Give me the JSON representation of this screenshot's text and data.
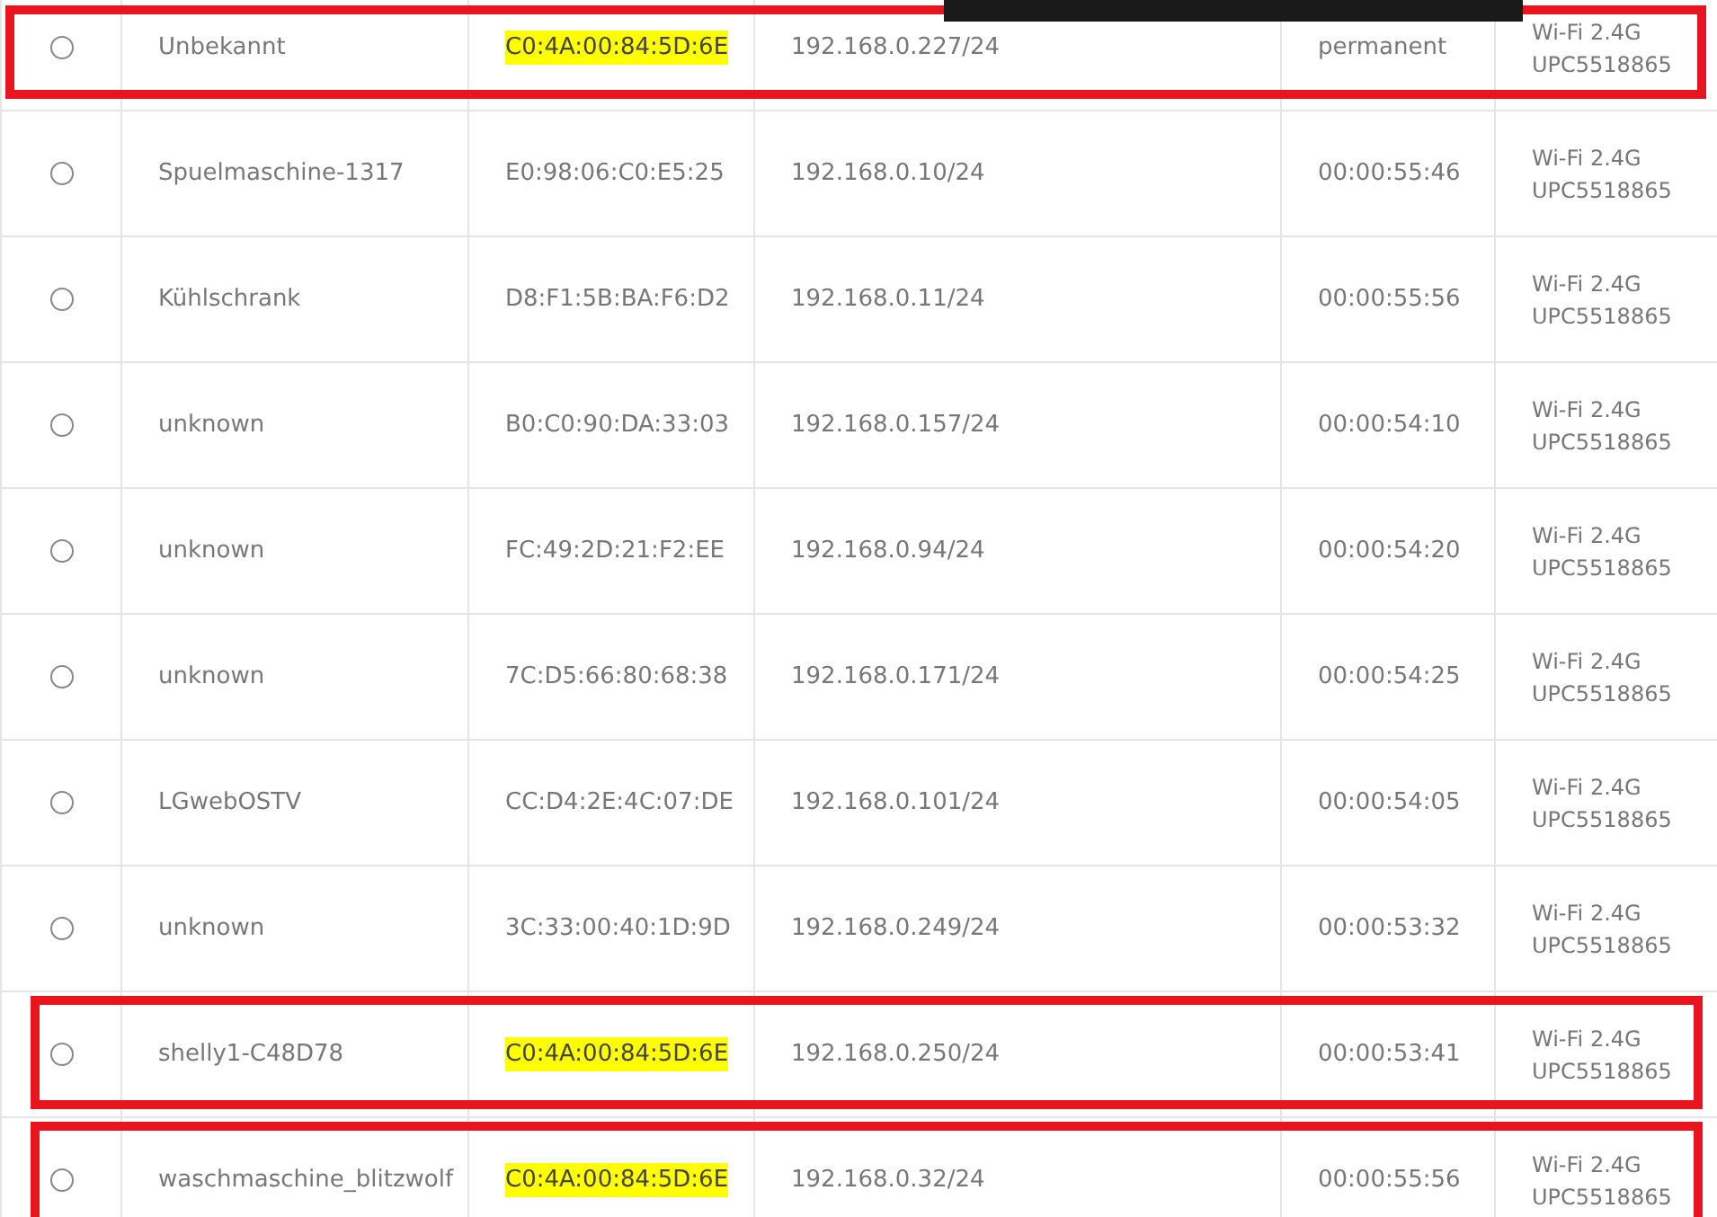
{
  "rows": [
    {
      "selected": false,
      "highlighted": true,
      "annotation": {
        "kind": "upper"
      },
      "name": "Unbekannt",
      "mac": "C0:4A:00:84:5D:6E",
      "ip": "192.168.0.227/24",
      "lease": "permanent",
      "network": [
        "Wi-Fi 2.4G",
        "UPC5518865"
      ]
    },
    {
      "selected": false,
      "highlighted": false,
      "name": "Spuelmaschine-1317",
      "mac": "E0:98:06:C0:E5:25",
      "ip": "192.168.0.10/24",
      "lease": "00:00:55:46",
      "network": [
        "Wi-Fi 2.4G",
        "UPC5518865"
      ]
    },
    {
      "selected": false,
      "highlighted": false,
      "name": "Kühlschrank",
      "mac": "D8:F1:5B:BA:F6:D2",
      "ip": "192.168.0.11/24",
      "lease": "00:00:55:56",
      "network": [
        "Wi-Fi 2.4G",
        "UPC5518865"
      ]
    },
    {
      "selected": false,
      "highlighted": false,
      "name": "unknown",
      "mac": "B0:C0:90:DA:33:03",
      "ip": "192.168.0.157/24",
      "lease": "00:00:54:10",
      "network": [
        "Wi-Fi 2.4G",
        "UPC5518865"
      ]
    },
    {
      "selected": false,
      "highlighted": false,
      "name": "unknown",
      "mac": "FC:49:2D:21:F2:EE",
      "ip": "192.168.0.94/24",
      "lease": "00:00:54:20",
      "network": [
        "Wi-Fi 2.4G",
        "UPC5518865"
      ]
    },
    {
      "selected": false,
      "highlighted": false,
      "name": "unknown",
      "mac": "7C:D5:66:80:68:38",
      "ip": "192.168.0.171/24",
      "lease": "00:00:54:25",
      "network": [
        "Wi-Fi 2.4G",
        "UPC5518865"
      ]
    },
    {
      "selected": false,
      "highlighted": false,
      "name": "LGwebOSTV",
      "mac": "CC:D4:2E:4C:07:DE",
      "ip": "192.168.0.101/24",
      "lease": "00:00:54:05",
      "network": [
        "Wi-Fi 2.4G",
        "UPC5518865"
      ]
    },
    {
      "selected": false,
      "highlighted": false,
      "name": "unknown",
      "mac": "3C:33:00:40:1D:9D",
      "ip": "192.168.0.249/24",
      "lease": "00:00:53:32",
      "network": [
        "Wi-Fi 2.4G",
        "UPC5518865"
      ]
    },
    {
      "selected": false,
      "highlighted": true,
      "annotation": {
        "kind": "full"
      },
      "name": "shelly1-C48D78",
      "mac": "C0:4A:00:84:5D:6E",
      "ip": "192.168.0.250/24",
      "lease": "00:00:53:41",
      "network": [
        "Wi-Fi 2.4G",
        "UPC5518865"
      ]
    },
    {
      "selected": false,
      "highlighted": true,
      "annotation": {
        "kind": "full"
      },
      "name": "waschmaschine_blitzwolf",
      "mac": "C0:4A:00:84:5D:6E",
      "ip": "192.168.0.32/24",
      "lease": "00:00:55:56",
      "network": [
        "Wi-Fi 2.4G",
        "UPC5518865"
      ]
    }
  ]
}
